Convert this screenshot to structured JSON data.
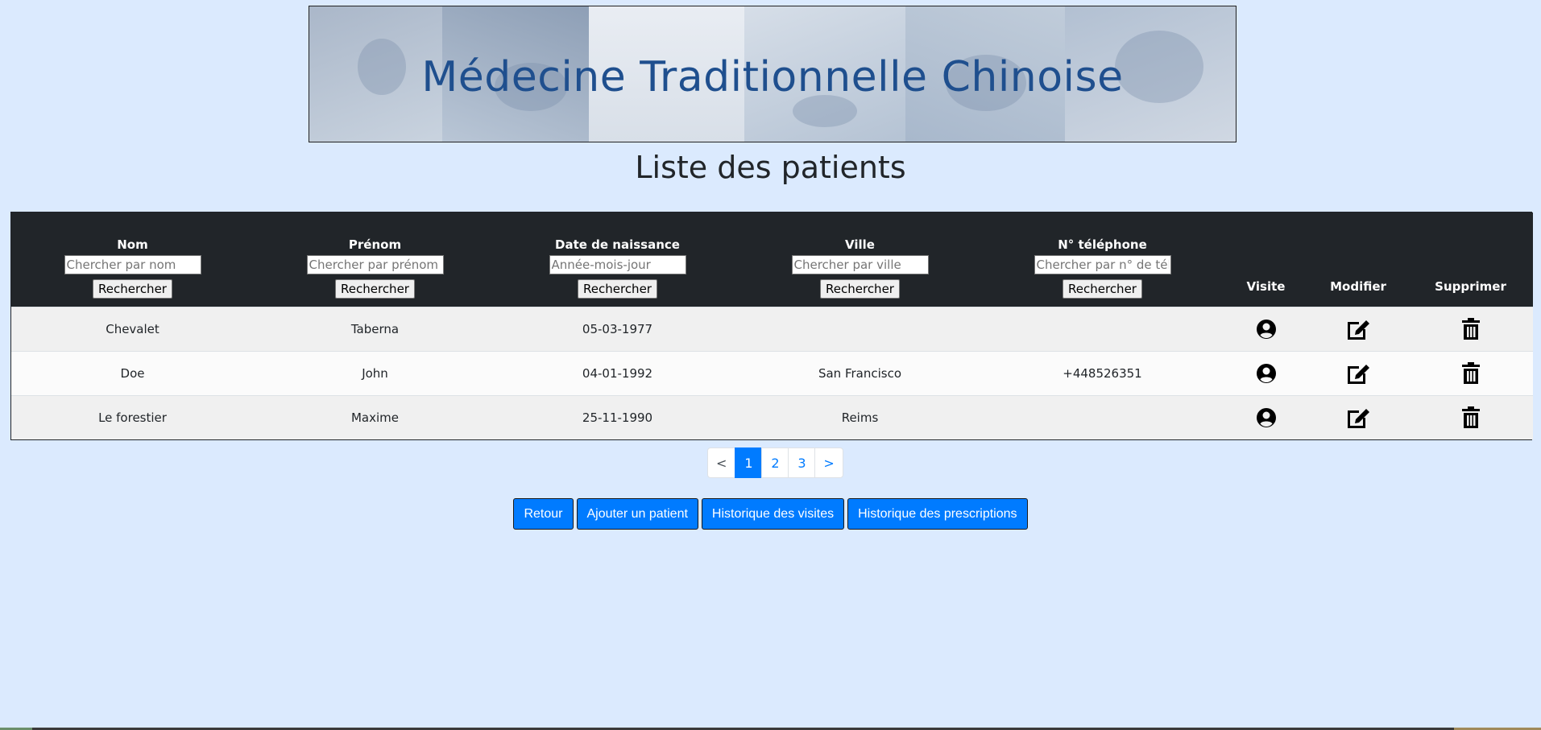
{
  "banner": {
    "title": "Médecine Traditionnelle Chinoise"
  },
  "page_title": "Liste des patients",
  "table": {
    "columns": [
      {
        "label": "Nom",
        "placeholder": "Chercher par nom",
        "button": "Rechercher"
      },
      {
        "label": "Prénom",
        "placeholder": "Chercher par prénom",
        "button": "Rechercher"
      },
      {
        "label": "Date de naissance",
        "placeholder": "Année-mois-jour",
        "button": "Rechercher"
      },
      {
        "label": "Ville",
        "placeholder": "Chercher par ville",
        "button": "Rechercher"
      },
      {
        "label": "N° téléphone",
        "placeholder": "Chercher par n° de téléphone",
        "button": "Rechercher"
      }
    ],
    "action_headers": {
      "visit": "Visite",
      "edit": "Modifier",
      "delete": "Supprimer"
    },
    "rows": [
      {
        "nom": "Chevalet",
        "prenom": "Taberna",
        "naissance": "05-03-1977",
        "ville": "",
        "telephone": ""
      },
      {
        "nom": "Doe",
        "prenom": "John",
        "naissance": "04-01-1992",
        "ville": "San Francisco",
        "telephone": "+448526351"
      },
      {
        "nom": "Le forestier",
        "prenom": "Maxime",
        "naissance": "25-11-1990",
        "ville": "Reims",
        "telephone": ""
      }
    ],
    "row_icons": {
      "visit": "user-circle-icon",
      "edit": "edit-icon",
      "delete": "trash-icon"
    }
  },
  "pagination": {
    "prev": "<",
    "pages": [
      "1",
      "2",
      "3"
    ],
    "active": "1",
    "next": ">"
  },
  "actions": {
    "back": "Retour",
    "add_patient": "Ajouter un patient",
    "visit_history": "Historique des visites",
    "prescription_history": "Historique des prescriptions"
  },
  "colors": {
    "background": "#dbeafe",
    "header_dark": "#212529",
    "primary": "#007bff",
    "banner_title": "#1f4f8e"
  }
}
